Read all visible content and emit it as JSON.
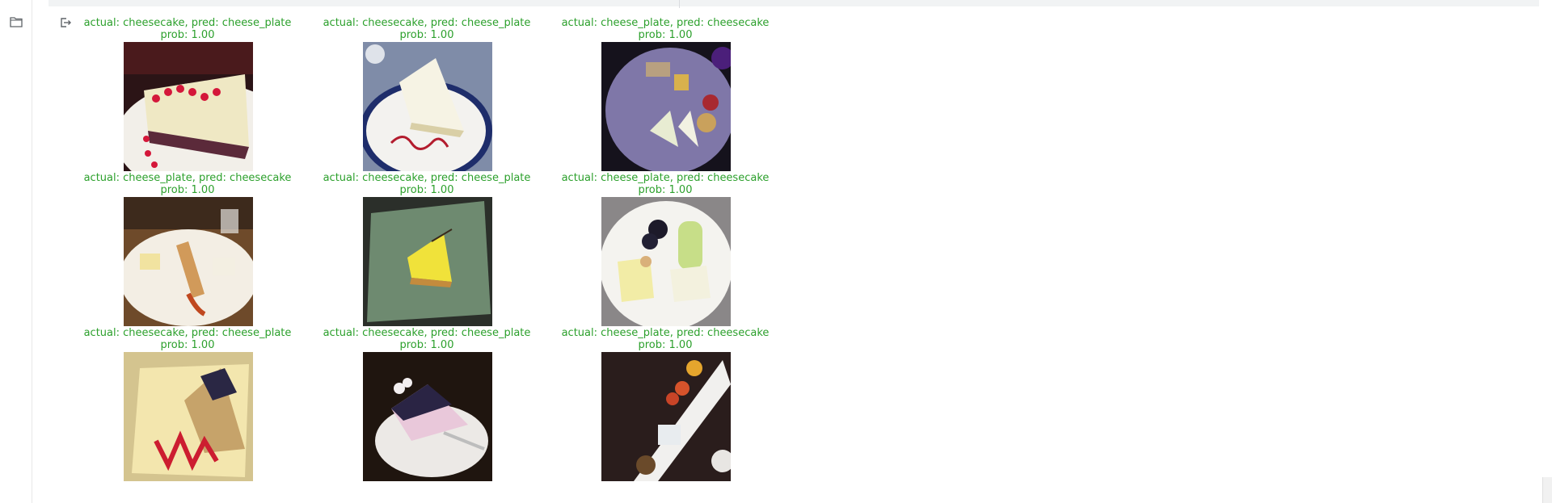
{
  "sidebar": {
    "icon": "folder-icon"
  },
  "output": {
    "icon": "output-arrow-icon"
  },
  "prediction_grid": [
    {
      "actual_pred": "actual: cheesecake, pred: cheese_plate",
      "prob": "prob: 1.00",
      "image": "cheesecake slice with red raspberry sauce dots on white plate"
    },
    {
      "actual_pred": "actual: cheesecake, pred: cheese_plate",
      "prob": "prob: 1.00",
      "image": "cheesecake slice on blue-rimmed plate with red sauce swirl"
    },
    {
      "actual_pred": "actual: cheese_plate, pred: cheesecake",
      "prob": "prob: 1.00",
      "image": "cheese plate on purple slate with assorted cheeses"
    },
    {
      "actual_pred": "actual: cheese_plate, pred: cheesecake",
      "prob": "prob: 1.00",
      "image": "cheese plate with crackers and caramel on wooden table"
    },
    {
      "actual_pred": "actual: cheesecake, pred: cheese_plate",
      "prob": "prob: 1.00",
      "image": "lemon cheesecake slice on green square plate"
    },
    {
      "actual_pred": "actual: cheese_plate, pred: cheesecake",
      "prob": "prob: 1.00",
      "image": "cheese plate with grapes, apple slices and cheeses"
    },
    {
      "actual_pred": "actual: cheesecake, pred: cheese_plate",
      "prob": "prob: 1.00",
      "image": "blueberry cheesecake on yellow plate with red zigzag sauce"
    },
    {
      "actual_pred": "actual: cheesecake, pred: cheese_plate",
      "prob": "prob: 1.00",
      "image": "blueberry cheesecake slice with fork on white plate"
    },
    {
      "actual_pred": "actual: cheese_plate, pred: cheesecake",
      "prob": "prob: 1.00",
      "image": "long white tray with cheeses and garnishes"
    }
  ],
  "colors": {
    "caption": "#2ca02c"
  }
}
